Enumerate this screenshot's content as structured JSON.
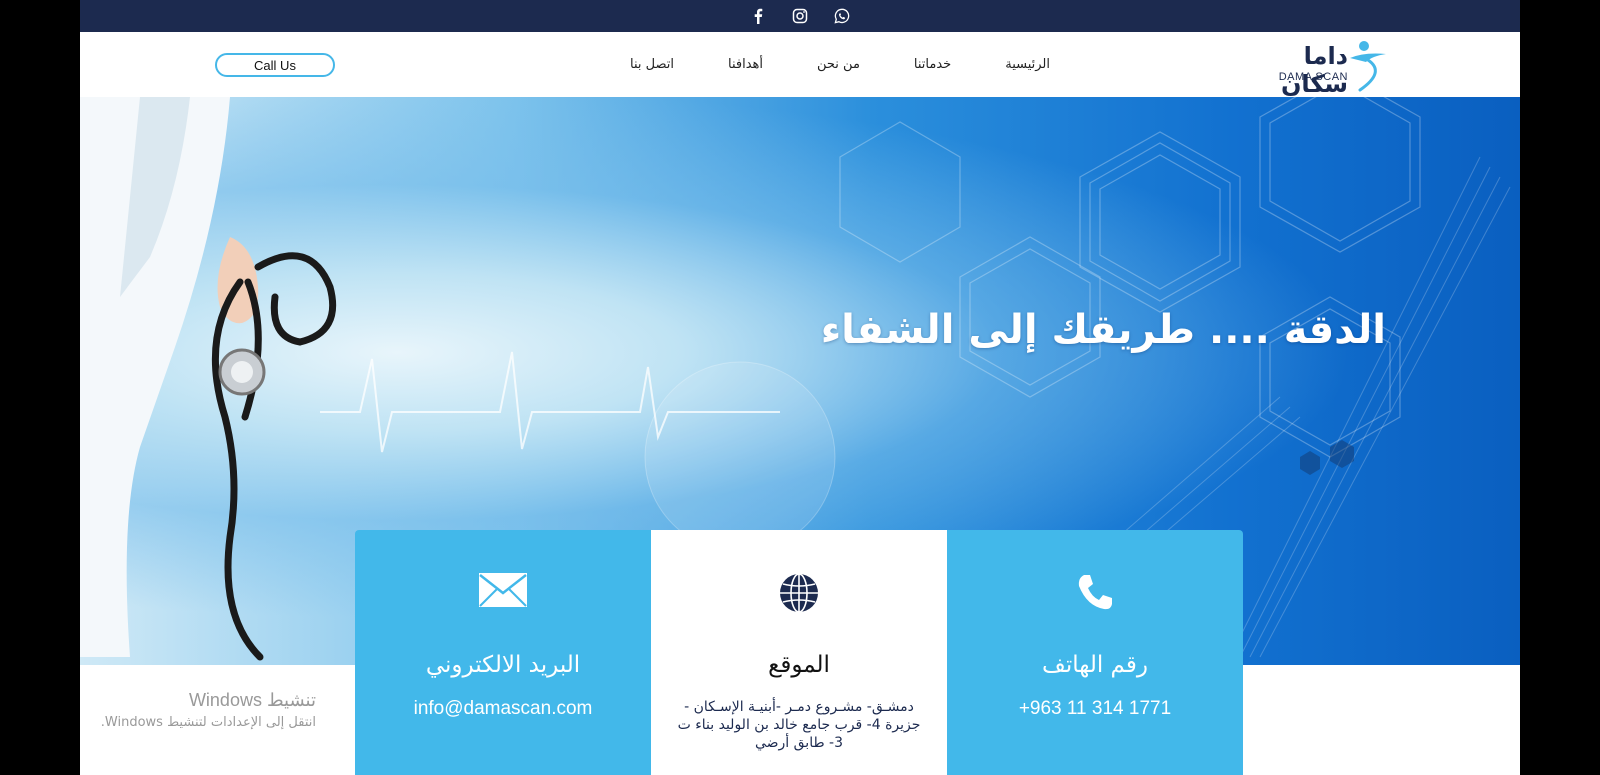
{
  "social": {
    "icons": [
      "facebook-icon",
      "instagram-icon",
      "whatsapp-icon"
    ]
  },
  "header": {
    "call_button": "Call Us",
    "nav": [
      "الرئيسية",
      "خدماتنا",
      "من نحن",
      "أهدافنا",
      "اتصل بنا"
    ],
    "logo_ar": "داما سكان",
    "logo_en": "DAMA SCAN"
  },
  "hero": {
    "headline": "الدقة .... طريقك إلى الشفاء"
  },
  "cards": {
    "phone": {
      "title": "رقم الهاتف",
      "value": "+963 11  314 1771",
      "icon": "phone-icon"
    },
    "location": {
      "title": "الموقع",
      "value": "دمشـق- مشـروع دمـر -أبنيـة الإسـكان - جزيرة 4- قرب جامع خالد بن الوليد بناء ت 3- طابق أرضي",
      "icon": "globe-icon"
    },
    "email": {
      "title": "البريد الالكتروني",
      "value": "info@damascan.com",
      "icon": "envelope-icon"
    }
  },
  "watermark": {
    "title": "تنشيط Windows",
    "subtitle": "انتقل إلى الإعدادات لتنشيط Windows."
  },
  "colors": {
    "navy": "#1c2a4f",
    "accent_blue": "#42b8ea"
  }
}
